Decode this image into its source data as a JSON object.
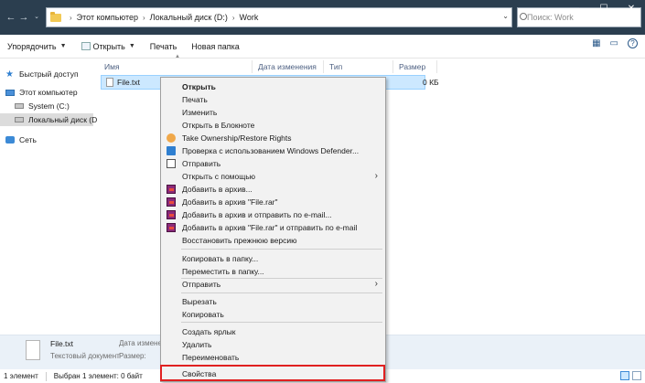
{
  "address": {
    "breadcrumb": [
      "Этот компьютер",
      "Локальный диск (D:)",
      "Work"
    ],
    "search_placeholder": "Поиск: Work"
  },
  "window_controls": {
    "minimize": "—",
    "maximize": "☐",
    "close": "✕"
  },
  "toolbar": {
    "organize": "Упорядочить",
    "open": "Открыть",
    "print": "Печать",
    "new_folder": "Новая папка"
  },
  "nav": {
    "quick_access": "Быстрый доступ",
    "this_pc": "Этот компьютер",
    "drive_c": "System (C:)",
    "drive_d": "Локальный диск (D",
    "network": "Сеть"
  },
  "columns": {
    "name": "Имя",
    "date_modified": "Дата изменения",
    "type": "Тип",
    "size": "Размер"
  },
  "file": {
    "name": "File.txt",
    "size": "0 КБ"
  },
  "details": {
    "name": "File.txt",
    "type": "Текстовый документ",
    "modified_label": "Дата изменен",
    "size_label": "Размер:"
  },
  "status": {
    "count": "1 элемент",
    "selection": "Выбран 1 элемент: 0 байт"
  },
  "context_menu": {
    "open": "Открыть",
    "print": "Печать",
    "edit": "Изменить",
    "open_notepad": "Открыть в Блокноте",
    "take_ownership": "Take Ownership/Restore Rights",
    "defender": "Проверка с использованием Windows Defender...",
    "share": "Отправить",
    "open_with": "Открыть с помощью",
    "add_archive": "Добавить в архив...",
    "add_file_rar": "Добавить в архив \"File.rar\"",
    "add_archive_email": "Добавить в архив и отправить по e-mail...",
    "add_rar_email": "Добавить в архив \"File.rar\" и отправить по e-mail",
    "restore_previous": "Восстановить прежнюю версию",
    "copy_to": "Копировать в папку...",
    "move_to": "Переместить в папку...",
    "send_to": "Отправить",
    "cut": "Вырезать",
    "copy": "Копировать",
    "create_shortcut": "Создать ярлык",
    "delete": "Удалить",
    "rename": "Переименовать",
    "properties": "Свойства"
  },
  "colors": {
    "title_bar": "#2b3e4f",
    "selection": "#cce8ff",
    "highlight": "#e02020"
  }
}
